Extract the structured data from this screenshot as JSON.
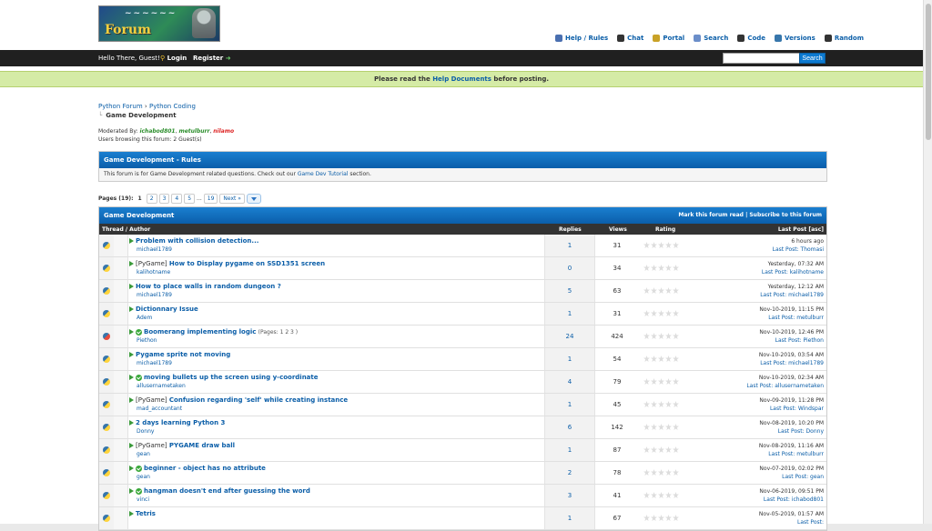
{
  "nav": {
    "items": [
      {
        "icon": "help-book-icon",
        "label": "Help / Rules",
        "color": "#4a6fb0"
      },
      {
        "icon": "hash-icon",
        "label": "Chat",
        "color": "#333333"
      },
      {
        "icon": "user-icon",
        "label": "Portal",
        "color": "#c9a227"
      },
      {
        "icon": "search-icon",
        "label": "Search",
        "color": "#6b8ec9"
      },
      {
        "icon": "code-icon",
        "label": "Code",
        "color": "#333333"
      },
      {
        "icon": "python-icon",
        "label": "Versions",
        "color": "#3776ab"
      },
      {
        "icon": "shuffle-icon",
        "label": "Random",
        "color": "#333333"
      }
    ]
  },
  "userbar": {
    "greeting": "Hello There, Guest!",
    "login": "Login",
    "register": "Register",
    "search_button": "Search",
    "search_value": ""
  },
  "notice": {
    "prefix": "Please read the ",
    "link": "Help Documents",
    "suffix": " before posting."
  },
  "breadcrumb": {
    "level1": "Python Forum",
    "level2": "Python Coding",
    "current": "Game Development"
  },
  "moderation": {
    "label": "Moderated By:",
    "mod1": "ichabod801",
    "mod2": "metulburr",
    "mod3": "nilamo",
    "browsing": "Users browsing this forum: 2 Guest(s)"
  },
  "rules": {
    "title": "Game Development - Rules",
    "text_before": "This forum is for Game Development related questions. Check out our ",
    "link": "Game Dev Tutorial",
    "text_after": " section."
  },
  "pagination": {
    "label": "Pages (19):",
    "pages": [
      "1",
      "2",
      "3",
      "4",
      "5"
    ],
    "ellipsis": "...",
    "last": "19",
    "next": "Next »"
  },
  "forum": {
    "title": "Game Development",
    "mark_read": "Mark this forum read",
    "separator": "|",
    "subscribe": "Subscribe to this forum",
    "columns": {
      "thread": "Thread / Author",
      "replies": "Replies",
      "views": "Views",
      "rating": "Rating",
      "lastpost": "Last Post [asc]"
    },
    "threads": [
      {
        "prefix": "",
        "title": "Problem with collision detection...",
        "author": "michael1789",
        "replies": "1",
        "views": "31",
        "date": "6 hours ago",
        "last_by": "Thomasi",
        "solved": false,
        "hot": false,
        "pages": ""
      },
      {
        "prefix": "[PyGame]",
        "title": "How to Display pygame on SSD1351 screen",
        "author": "kalihotname",
        "replies": "0",
        "views": "34",
        "date": "Yesterday, 07:32 AM",
        "last_by": "kalihotname",
        "solved": false,
        "hot": false,
        "pages": ""
      },
      {
        "prefix": "",
        "title": "How to place walls in random dungeon ?",
        "author": "michael1789",
        "replies": "5",
        "views": "63",
        "date": "Yesterday, 12:12 AM",
        "last_by": "michael1789",
        "solved": false,
        "hot": false,
        "pages": ""
      },
      {
        "prefix": "",
        "title": "Dictionnary Issue",
        "author": "Adem",
        "replies": "1",
        "views": "31",
        "date": "Nov-10-2019, 11:15 PM",
        "last_by": "metulburr",
        "solved": false,
        "hot": false,
        "pages": ""
      },
      {
        "prefix": "",
        "title": "Boomerang implementing logic",
        "author": "Piethon",
        "replies": "24",
        "views": "424",
        "date": "Nov-10-2019, 12:46 PM",
        "last_by": "Piethon",
        "solved": true,
        "hot": true,
        "pages": "(Pages: 1 2 3 )"
      },
      {
        "prefix": "",
        "title": "Pygame sprite not moving",
        "author": "michael1789",
        "replies": "1",
        "views": "54",
        "date": "Nov-10-2019, 03:54 AM",
        "last_by": "michael1789",
        "solved": false,
        "hot": false,
        "pages": ""
      },
      {
        "prefix": "",
        "title": "moving bullets up the screen using y-coordinate",
        "author": "allusernametaken",
        "replies": "4",
        "views": "79",
        "date": "Nov-10-2019, 02:34 AM",
        "last_by": "allusernametaken",
        "solved": true,
        "hot": false,
        "pages": ""
      },
      {
        "prefix": "[PyGame]",
        "title": "Confusion regarding 'self' while creating instance",
        "author": "mad_accountant",
        "replies": "1",
        "views": "45",
        "date": "Nov-09-2019, 11:28 PM",
        "last_by": "Windspar",
        "solved": false,
        "hot": false,
        "pages": ""
      },
      {
        "prefix": "",
        "title": "2 days learning Python 3",
        "author": "Donny",
        "replies": "6",
        "views": "142",
        "date": "Nov-08-2019, 10:20 PM",
        "last_by": "Donny",
        "solved": false,
        "hot": false,
        "pages": ""
      },
      {
        "prefix": "[PyGame]",
        "title": "PYGAME draw ball",
        "author": "gean",
        "replies": "1",
        "views": "87",
        "date": "Nov-08-2019, 11:16 AM",
        "last_by": "metulburr",
        "solved": false,
        "hot": false,
        "pages": ""
      },
      {
        "prefix": "",
        "title": "beginner - object has no attribute",
        "author": "gean",
        "replies": "2",
        "views": "78",
        "date": "Nov-07-2019, 02:02 PM",
        "last_by": "gean",
        "solved": true,
        "hot": false,
        "pages": ""
      },
      {
        "prefix": "",
        "title": "hangman doesn't end after guessing the word",
        "author": "vinci",
        "replies": "3",
        "views": "41",
        "date": "Nov-06-2019, 09:51 PM",
        "last_by": "ichabod801",
        "solved": true,
        "hot": false,
        "pages": ""
      },
      {
        "prefix": "",
        "title": "Tetris",
        "author": "",
        "replies": "1",
        "views": "67",
        "date": "Nov-05-2019, 01:57 AM",
        "last_by": "",
        "solved": false,
        "hot": false,
        "pages": ""
      }
    ]
  },
  "labels": {
    "last_post": "Last Post: "
  }
}
